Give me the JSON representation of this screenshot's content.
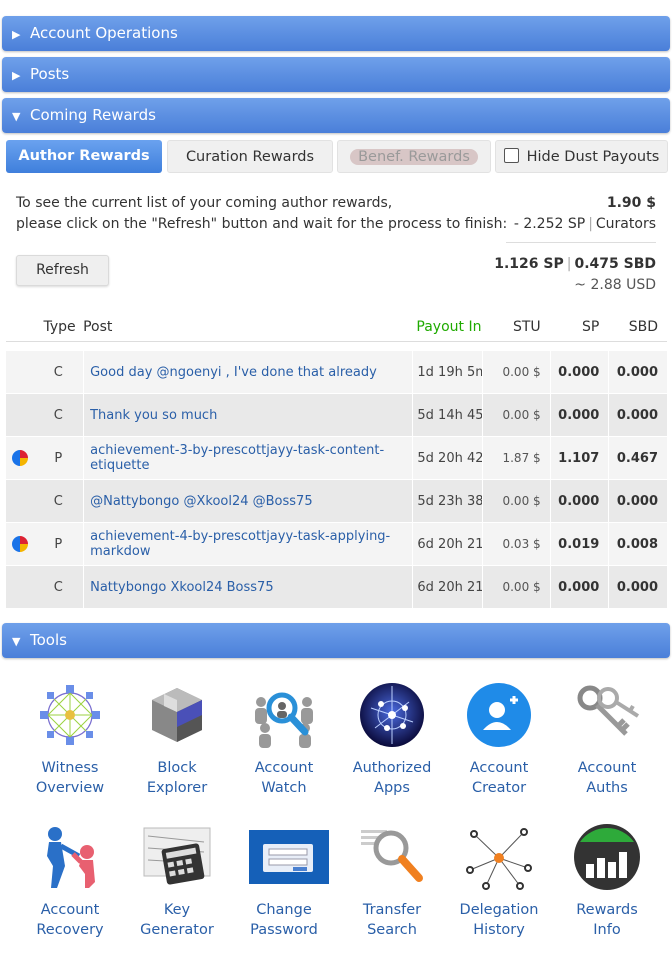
{
  "headers": {
    "account_operations": "Account Operations",
    "posts": "Posts",
    "coming_rewards": "Coming Rewards",
    "tools": "Tools"
  },
  "tabs": {
    "author": "Author Rewards",
    "curation": "Curation Rewards",
    "benef": "Benef. Rewards",
    "hide_dust": "Hide Dust Payouts"
  },
  "info": {
    "line1": "To see the current list of your coming author rewards,",
    "line2": "please click on the \"Refresh\" button and wait for the process to finish:"
  },
  "summary": {
    "total": "1.90 $",
    "curators_sp": "- 2.252 SP",
    "curators_label": "Curators",
    "sp": "1.126 SP",
    "sbd": "0.475 SBD",
    "usd": "~ 2.88 USD"
  },
  "refresh_label": "Refresh",
  "table": {
    "headers": {
      "type": "Type",
      "post": "Post",
      "payout": "Payout In",
      "stu": "STU",
      "sp": "SP",
      "sbd": "SBD"
    },
    "rows": [
      {
        "icon": "",
        "type": "C",
        "post": "Good day @ngoenyi , I've done that already",
        "payout": "1d 19h 5m",
        "stu": "0.00 $",
        "sp": "0.000",
        "sbd": "0.000"
      },
      {
        "icon": "",
        "type": "C",
        "post": "Thank you so much",
        "payout": "5d 14h 45",
        "stu": "0.00 $",
        "sp": "0.000",
        "sbd": "0.000"
      },
      {
        "icon": "pie-chart-icon",
        "type": "P",
        "post": "achievement-3-by-prescottjayy-task-content-etiquette",
        "payout": "5d 20h 42",
        "stu": "1.87 $",
        "sp": "1.107",
        "sbd": "0.467"
      },
      {
        "icon": "",
        "type": "C",
        "post": "@Nattybongo @Xkool24 @Boss75",
        "payout": "5d 23h 38",
        "stu": "0.00 $",
        "sp": "0.000",
        "sbd": "0.000"
      },
      {
        "icon": "pie-chart-icon",
        "type": "P",
        "post": "achievement-4-by-prescottjayy-task-applying-markdow",
        "payout": "6d 20h 21",
        "stu": "0.03 $",
        "sp": "0.019",
        "sbd": "0.008"
      },
      {
        "icon": "",
        "type": "C",
        "post": "Nattybongo Xkool24 Boss75",
        "payout": "6d 20h 21",
        "stu": "0.00 $",
        "sp": "0.000",
        "sbd": "0.000"
      }
    ]
  },
  "tools": [
    {
      "line1": "Witness",
      "line2": "Overview",
      "icon": "witness-network-icon"
    },
    {
      "line1": "Block",
      "line2": "Explorer",
      "icon": "cubes-icon"
    },
    {
      "line1": "Account",
      "line2": "Watch",
      "icon": "magnifier-people-icon"
    },
    {
      "line1": "Authorized",
      "line2": "Apps",
      "icon": "network-sphere-icon"
    },
    {
      "line1": "Account",
      "line2": "Creator",
      "icon": "add-user-icon"
    },
    {
      "line1": "Account",
      "line2": "Auths",
      "icon": "keys-icon"
    },
    {
      "line1": "Account",
      "line2": "Recovery",
      "icon": "helping-hand-icon"
    },
    {
      "line1": "Key",
      "line2": "Generator",
      "icon": "calculator-icon"
    },
    {
      "line1": "Change",
      "line2": "Password",
      "icon": "login-form-icon"
    },
    {
      "line1": "Transfer",
      "line2": "Search",
      "icon": "search-icon"
    },
    {
      "line1": "Delegation",
      "line2": "History",
      "icon": "delegation-graph-icon"
    },
    {
      "line1": "Rewards",
      "line2": "Info",
      "icon": "bar-chart-icon"
    }
  ],
  "colors": {
    "header": "#4a7fd9",
    "link": "#2a5fa8",
    "payout_header": "#1faa00"
  }
}
